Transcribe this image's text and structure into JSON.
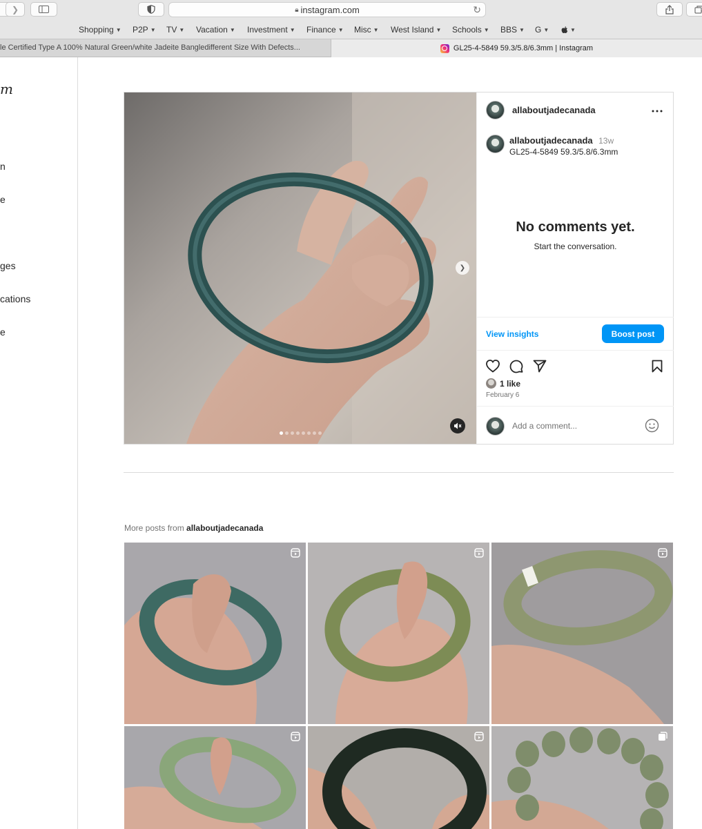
{
  "browser": {
    "url": "instagram.com",
    "bookmarks": [
      "Shopping",
      "P2P",
      "TV",
      "Vacation",
      "Investment",
      "Finance",
      "Misc",
      "West Island",
      "Schools",
      "BBS",
      "G",
      ""
    ],
    "tabs": [
      {
        "title": "le Certified Type A 100% Natural Green/white Jadeite Bangledifferent Size With Defects..."
      },
      {
        "title": "GL25-4-5849 59.3/5.8/6.3mm | Instagram"
      }
    ]
  },
  "sidenav": {
    "logo": "m",
    "items": [
      "n",
      "e",
      "ges",
      "cations",
      "e"
    ]
  },
  "post": {
    "username": "allaboutjadecanada",
    "caption_username": "allaboutjadecanada",
    "caption_age": "13w",
    "caption": "GL25-4-5849 59.3/5.8/6.3mm",
    "empty_title": "No comments yet.",
    "empty_subtitle": "Start the conversation.",
    "insights_label": "View insights",
    "boost_label": "Boost post",
    "likes": "1 like",
    "date": "February 6",
    "comment_placeholder": "Add a comment...",
    "carousel_count": 8,
    "carousel_active": 1
  },
  "more_posts": {
    "prefix": "More posts from",
    "username": "allaboutjadecanada",
    "items": [
      {
        "type": "reel",
        "color": "#3e6a63"
      },
      {
        "type": "reel",
        "color": "#7d8c55"
      },
      {
        "type": "reel",
        "color": "#8e9770"
      },
      {
        "type": "reel",
        "color": "#8aa67a"
      },
      {
        "type": "reel",
        "color": "#1f2a22"
      },
      {
        "type": "carousel",
        "color": "#7f8d6b"
      }
    ]
  }
}
